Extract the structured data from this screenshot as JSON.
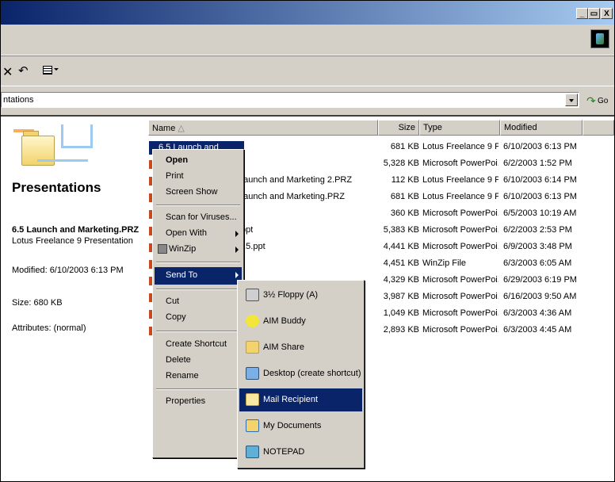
{
  "window": {
    "controls": [
      "_",
      "&#8203;",
      "X"
    ],
    "control_min": "_",
    "control_max": " ",
    "control_close": "X"
  },
  "address": {
    "text": "ntations",
    "go_label": "Go"
  },
  "left_pane": {
    "title": "Presentations",
    "file_name": "6.5 Launch and Marketing.PRZ",
    "file_type": "Lotus Freelance 9 Presentation",
    "modified": "Modified: 6/10/2003 6:13 PM",
    "size": "Size: 680 KB",
    "attributes": "Attributes: (normal)"
  },
  "columns": {
    "name": "Name",
    "size": "Size",
    "type": "Type",
    "modified": "Modified"
  },
  "selected_name": "6.5 Launch and Marketing.PRZ",
  "files": [
    {
      "name": "",
      "size": "681 KB",
      "type": "Lotus Freelance 9 P...",
      "modified": "6/10/2003 6:13 PM"
    },
    {
      "name": "",
      "size": "5,328 KB",
      "type": "Microsoft PowerPoi...",
      "modified": "6/2/2003 1:52 PM"
    },
    {
      "name": "Launch and Marketing 2.PRZ",
      "size": "112 KB",
      "type": "Lotus Freelance 9 P...",
      "modified": "6/10/2003 6:14 PM"
    },
    {
      "name": "Launch and Marketing.PRZ",
      "size": "681 KB",
      "type": "Lotus Freelance 9 P...",
      "modified": "6/10/2003 6:13 PM"
    },
    {
      "name": "",
      "size": "360 KB",
      "type": "Microsoft PowerPoi...",
      "modified": "6/5/2003 10:19 AM"
    },
    {
      "name": ".ppt",
      "size": "5,383 KB",
      "type": "Microsoft PowerPoi...",
      "modified": "6/2/2003 2:53 PM"
    },
    {
      "name": "6.5.ppt",
      "size": "4,441 KB",
      "type": "Microsoft PowerPoi...",
      "modified": "6/9/2003 3:48 PM"
    },
    {
      "name": "",
      "size": "4,451 KB",
      "type": "WinZip File",
      "modified": "6/3/2003 6:05 AM"
    },
    {
      "name": "",
      "size": "4,329 KB",
      "type": "Microsoft PowerPoi...",
      "modified": "6/29/2003 6:19 PM"
    },
    {
      "name": "",
      "size": "3,987 KB",
      "type": "Microsoft PowerPoi...",
      "modified": "6/16/2003 9:50 AM"
    },
    {
      "name": "",
      "size": "1,049 KB",
      "type": "Microsoft PowerPoi...",
      "modified": "6/3/2003 4:36 AM"
    },
    {
      "name": "",
      "size": "2,893 KB",
      "type": "Microsoft PowerPoi...",
      "modified": "6/3/2003 4:45 AM"
    }
  ],
  "context_menu": {
    "open": "Open",
    "print": "Print",
    "screen_show": "Screen Show",
    "scan": "Scan for Viruses...",
    "open_with": "Open With",
    "winzip": "WinZip",
    "send_to": "Send To",
    "cut": "Cut",
    "copy": "Copy",
    "create_shortcut": "Create Shortcut",
    "delete": "Delete",
    "rename": "Rename",
    "properties": "Properties"
  },
  "send_to_menu": {
    "floppy": "3½ Floppy (A)",
    "aim_buddy": "AIM Buddy",
    "aim_share": "AIM Share",
    "desktop": "Desktop (create shortcut)",
    "mail": "Mail Recipient",
    "my_documents": "My Documents",
    "notepad": "NOTEPAD"
  },
  "colors": {
    "title_gradient_start": "#0a246a",
    "highlight": "#0a246a",
    "face": "#d4d0c8"
  }
}
